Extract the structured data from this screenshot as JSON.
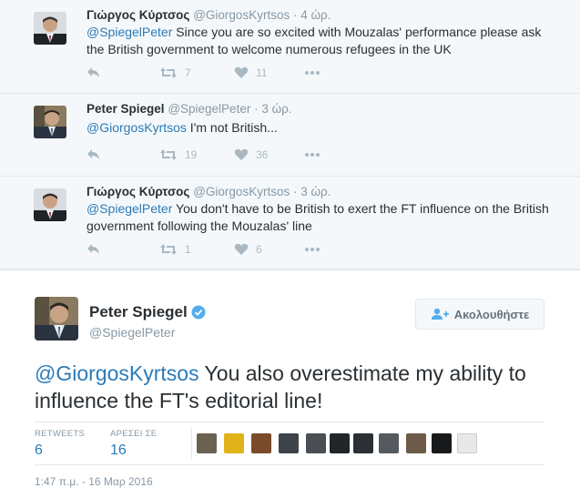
{
  "replies": [
    {
      "name": "Γιώργος Κύρτσος",
      "handle": "@GiorgosKyrtsos",
      "time": "· 4 ώρ.",
      "mention": "@SpiegelPeter",
      "text": " Since you are so excited with Mouzalas' performance please ask the British government to welcome numerous refugees in the UK",
      "retweets": "7",
      "likes": "11"
    },
    {
      "name": "Peter Spiegel",
      "handle": "@SpiegelPeter",
      "time": "· 3 ώρ.",
      "mention": "@GiorgosKyrtsos",
      "text": " I'm not British...",
      "retweets": "19",
      "likes": "36"
    },
    {
      "name": "Γιώργος Κύρτσος",
      "handle": "@GiorgosKyrtsos",
      "time": "· 3 ώρ.",
      "mention": "@SpiegelPeter",
      "text": " You don't have to be British to exert the FT influence on the British government following the Mouzalas' line",
      "retweets": "1",
      "likes": "6"
    }
  ],
  "main_tweet": {
    "name": "Peter Spiegel",
    "handle": "@SpiegelPeter",
    "follow_label": "Ακολουθήστε",
    "mention": "@GiorgosKyrtsos",
    "text": " You also overestimate my ability to influence the FT's editorial line!",
    "retweets_label": "RETWEETS",
    "retweets_value": "6",
    "likes_label": "ΑΡΕΣΕΙ ΣΕ",
    "likes_value": "16",
    "timestamp": "1:47 π.μ. - 16 Μαρ 2016"
  },
  "colors": {
    "link": "#2b7bb9",
    "verified": "#55acee",
    "muted": "#8899a6",
    "icons": "#aab8c2"
  },
  "icons": {
    "reply": "reply-icon",
    "retweet": "retweet-icon",
    "like": "heart-icon",
    "more": "more-icon",
    "verified": "verified-badge-icon",
    "follow": "follow-user-icon"
  }
}
